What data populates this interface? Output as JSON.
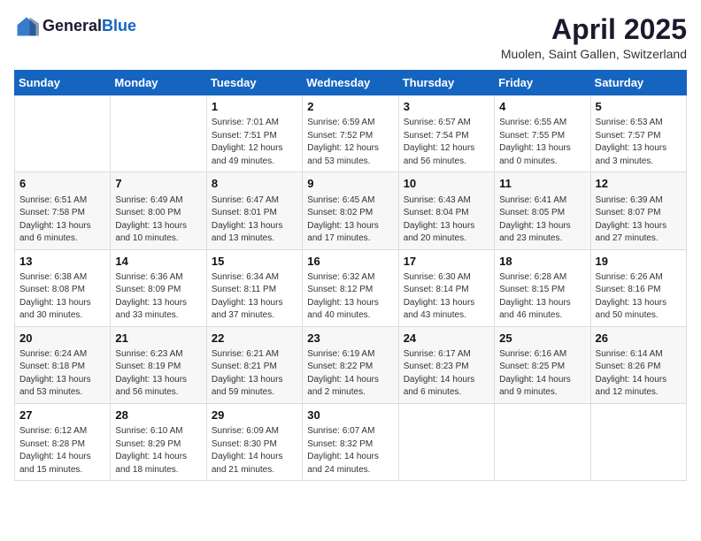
{
  "header": {
    "logo_general": "General",
    "logo_blue": "Blue",
    "title": "April 2025",
    "location": "Muolen, Saint Gallen, Switzerland"
  },
  "weekdays": [
    "Sunday",
    "Monday",
    "Tuesday",
    "Wednesday",
    "Thursday",
    "Friday",
    "Saturday"
  ],
  "weeks": [
    [
      {
        "day": "",
        "info": ""
      },
      {
        "day": "",
        "info": ""
      },
      {
        "day": "1",
        "info": "Sunrise: 7:01 AM\nSunset: 7:51 PM\nDaylight: 12 hours and 49 minutes."
      },
      {
        "day": "2",
        "info": "Sunrise: 6:59 AM\nSunset: 7:52 PM\nDaylight: 12 hours and 53 minutes."
      },
      {
        "day": "3",
        "info": "Sunrise: 6:57 AM\nSunset: 7:54 PM\nDaylight: 12 hours and 56 minutes."
      },
      {
        "day": "4",
        "info": "Sunrise: 6:55 AM\nSunset: 7:55 PM\nDaylight: 13 hours and 0 minutes."
      },
      {
        "day": "5",
        "info": "Sunrise: 6:53 AM\nSunset: 7:57 PM\nDaylight: 13 hours and 3 minutes."
      }
    ],
    [
      {
        "day": "6",
        "info": "Sunrise: 6:51 AM\nSunset: 7:58 PM\nDaylight: 13 hours and 6 minutes."
      },
      {
        "day": "7",
        "info": "Sunrise: 6:49 AM\nSunset: 8:00 PM\nDaylight: 13 hours and 10 minutes."
      },
      {
        "day": "8",
        "info": "Sunrise: 6:47 AM\nSunset: 8:01 PM\nDaylight: 13 hours and 13 minutes."
      },
      {
        "day": "9",
        "info": "Sunrise: 6:45 AM\nSunset: 8:02 PM\nDaylight: 13 hours and 17 minutes."
      },
      {
        "day": "10",
        "info": "Sunrise: 6:43 AM\nSunset: 8:04 PM\nDaylight: 13 hours and 20 minutes."
      },
      {
        "day": "11",
        "info": "Sunrise: 6:41 AM\nSunset: 8:05 PM\nDaylight: 13 hours and 23 minutes."
      },
      {
        "day": "12",
        "info": "Sunrise: 6:39 AM\nSunset: 8:07 PM\nDaylight: 13 hours and 27 minutes."
      }
    ],
    [
      {
        "day": "13",
        "info": "Sunrise: 6:38 AM\nSunset: 8:08 PM\nDaylight: 13 hours and 30 minutes."
      },
      {
        "day": "14",
        "info": "Sunrise: 6:36 AM\nSunset: 8:09 PM\nDaylight: 13 hours and 33 minutes."
      },
      {
        "day": "15",
        "info": "Sunrise: 6:34 AM\nSunset: 8:11 PM\nDaylight: 13 hours and 37 minutes."
      },
      {
        "day": "16",
        "info": "Sunrise: 6:32 AM\nSunset: 8:12 PM\nDaylight: 13 hours and 40 minutes."
      },
      {
        "day": "17",
        "info": "Sunrise: 6:30 AM\nSunset: 8:14 PM\nDaylight: 13 hours and 43 minutes."
      },
      {
        "day": "18",
        "info": "Sunrise: 6:28 AM\nSunset: 8:15 PM\nDaylight: 13 hours and 46 minutes."
      },
      {
        "day": "19",
        "info": "Sunrise: 6:26 AM\nSunset: 8:16 PM\nDaylight: 13 hours and 50 minutes."
      }
    ],
    [
      {
        "day": "20",
        "info": "Sunrise: 6:24 AM\nSunset: 8:18 PM\nDaylight: 13 hours and 53 minutes."
      },
      {
        "day": "21",
        "info": "Sunrise: 6:23 AM\nSunset: 8:19 PM\nDaylight: 13 hours and 56 minutes."
      },
      {
        "day": "22",
        "info": "Sunrise: 6:21 AM\nSunset: 8:21 PM\nDaylight: 13 hours and 59 minutes."
      },
      {
        "day": "23",
        "info": "Sunrise: 6:19 AM\nSunset: 8:22 PM\nDaylight: 14 hours and 2 minutes."
      },
      {
        "day": "24",
        "info": "Sunrise: 6:17 AM\nSunset: 8:23 PM\nDaylight: 14 hours and 6 minutes."
      },
      {
        "day": "25",
        "info": "Sunrise: 6:16 AM\nSunset: 8:25 PM\nDaylight: 14 hours and 9 minutes."
      },
      {
        "day": "26",
        "info": "Sunrise: 6:14 AM\nSunset: 8:26 PM\nDaylight: 14 hours and 12 minutes."
      }
    ],
    [
      {
        "day": "27",
        "info": "Sunrise: 6:12 AM\nSunset: 8:28 PM\nDaylight: 14 hours and 15 minutes."
      },
      {
        "day": "28",
        "info": "Sunrise: 6:10 AM\nSunset: 8:29 PM\nDaylight: 14 hours and 18 minutes."
      },
      {
        "day": "29",
        "info": "Sunrise: 6:09 AM\nSunset: 8:30 PM\nDaylight: 14 hours and 21 minutes."
      },
      {
        "day": "30",
        "info": "Sunrise: 6:07 AM\nSunset: 8:32 PM\nDaylight: 14 hours and 24 minutes."
      },
      {
        "day": "",
        "info": ""
      },
      {
        "day": "",
        "info": ""
      },
      {
        "day": "",
        "info": ""
      }
    ]
  ]
}
